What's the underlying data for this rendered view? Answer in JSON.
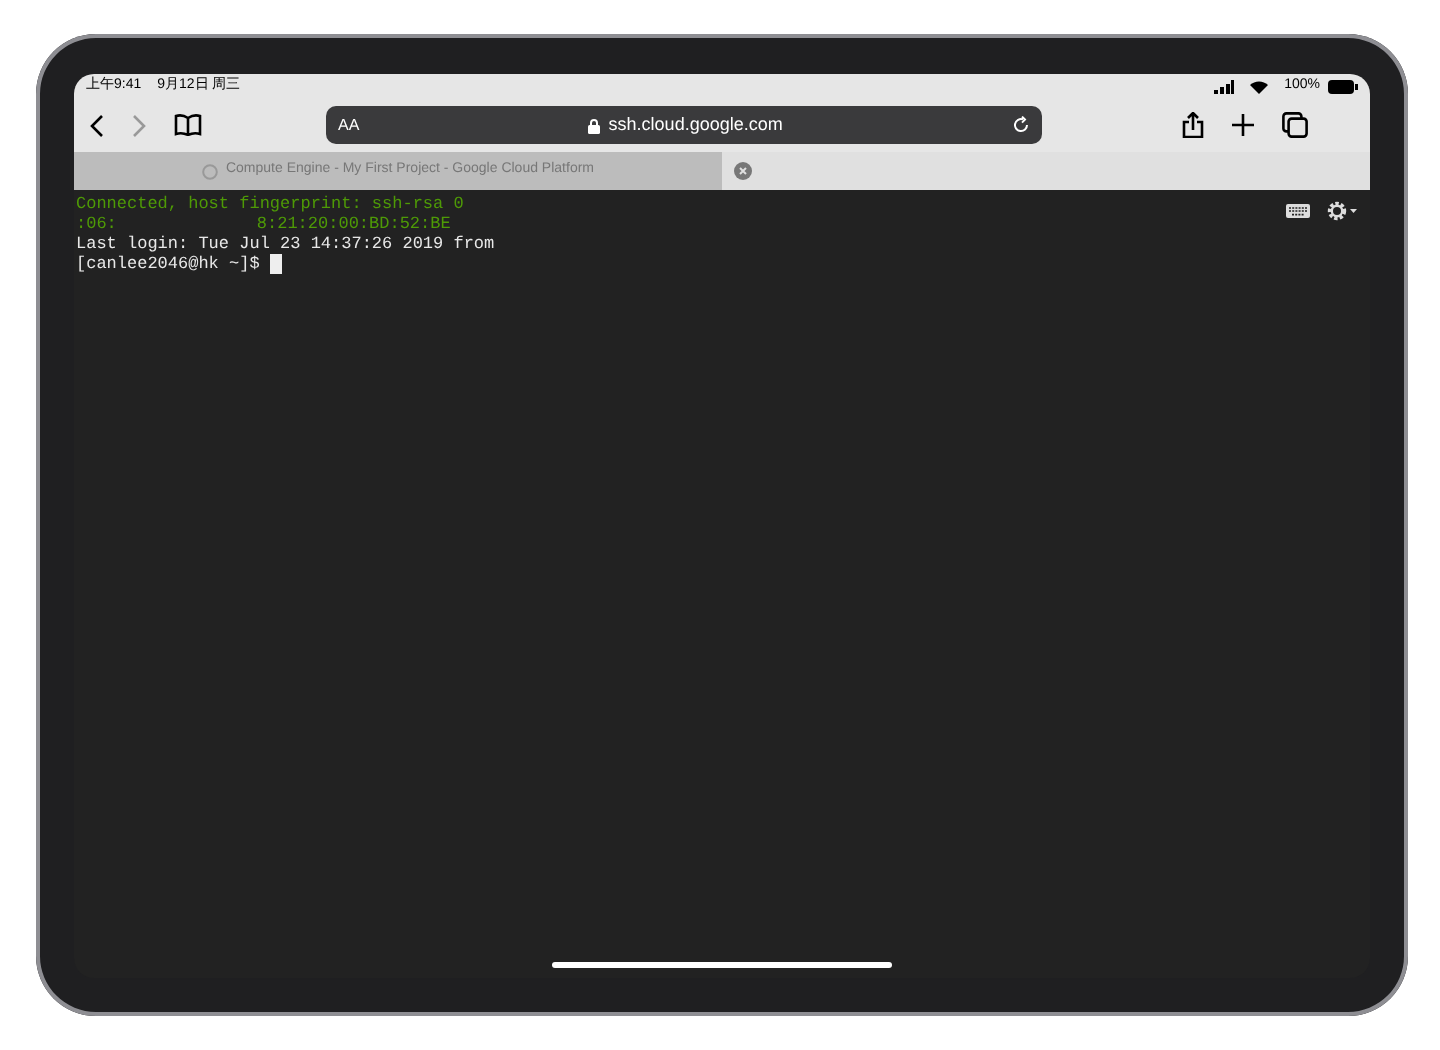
{
  "status_bar": {
    "time": "上午9:41",
    "date": "9月12日 周三",
    "battery": "100%"
  },
  "toolbar": {
    "reader_button": "AA",
    "address": "ssh.cloud.google.com"
  },
  "tabs": [
    {
      "title": "Compute Engine - My First Project - Google Cloud Platform",
      "selected": false
    },
    {
      "selected": true
    }
  ],
  "terminal": {
    "lines": [
      {
        "kind": "info",
        "segments": [
          "Connected, host fingerprint: ssh-rsa 0"
        ]
      },
      {
        "kind": "info",
        "segments": [
          ":06:",
          "8:21:20:00:BD:52:BE"
        ]
      },
      {
        "kind": "output",
        "segments": [
          "Last login: Tue Jul 23 14:37:26 2019 from"
        ]
      },
      {
        "kind": "prompt",
        "segments": [
          "[canlee2046@hk ~]$"
        ]
      }
    ]
  }
}
